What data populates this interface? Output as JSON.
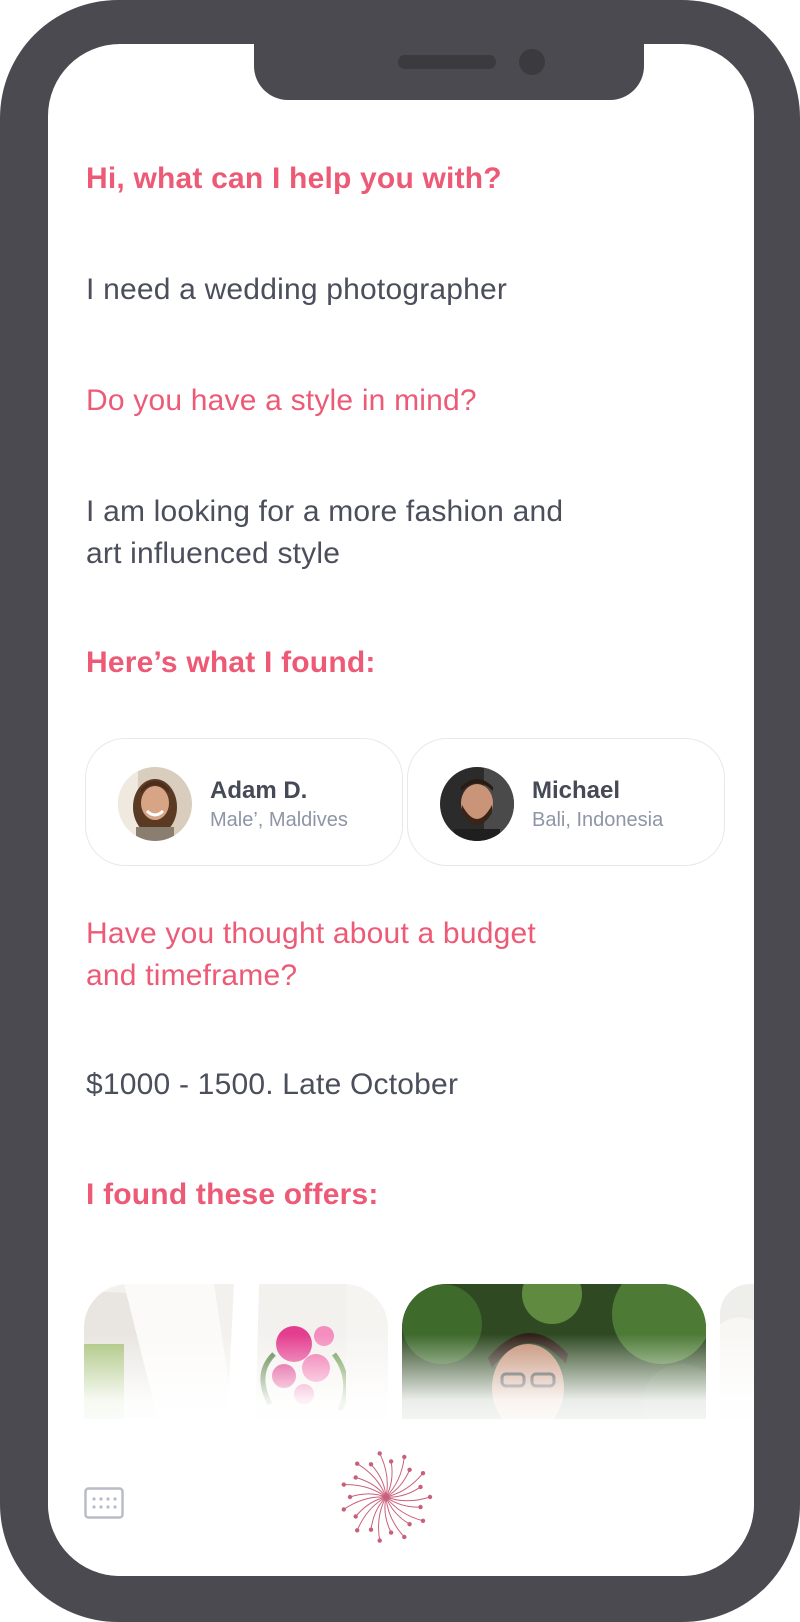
{
  "conversation": {
    "greeting": "Hi, what can I help you with?",
    "reply_1": "I need a wedding photographer",
    "question_style": "Do you have a style in mind?",
    "reply_2_line_1": "I am looking for a more fashion and",
    "reply_2_line_2": "art influenced style",
    "found_heading": "Here’s what I found:",
    "question_budget_line_1": "Have you thought about a budget",
    "question_budget_line_2": "and timeframe?",
    "reply_3": "$1000 - 1500. Late October",
    "offers_heading": "I found these offers:"
  },
  "photographers": [
    {
      "name": "Adam D.",
      "location": "Male’, Maldives"
    },
    {
      "name": "Michael",
      "location": "Bali, Indonesia"
    }
  ],
  "icons": {
    "keyboard": "keyboard-icon",
    "assistant_logo": "dandelion-logo-icon"
  },
  "colors": {
    "accent": "#ec5a76",
    "text": "#4b4f5c",
    "muted": "#8e95a6",
    "phone": "#4a4a50"
  }
}
